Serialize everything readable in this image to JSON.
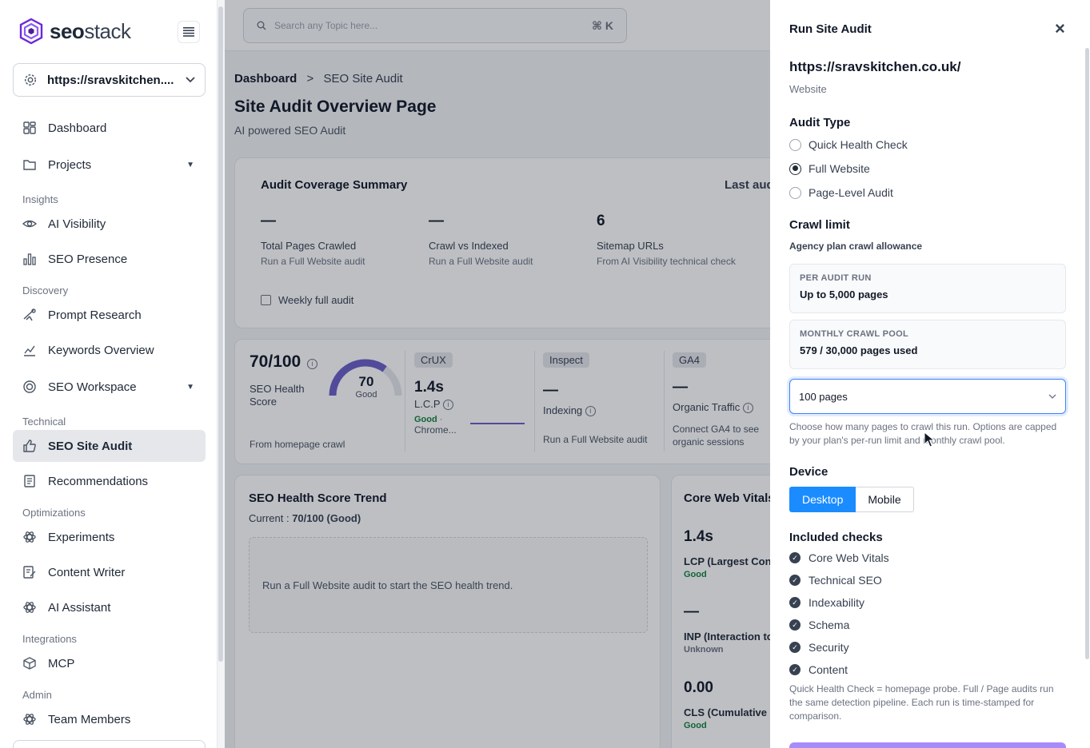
{
  "brand": {
    "name_bold": "seo",
    "name_light": "stack"
  },
  "site_select": {
    "value": "https://sravskitchen...."
  },
  "sidebar": {
    "dashboard": "Dashboard",
    "projects": "Projects",
    "sections": {
      "insights": "Insights",
      "discovery": "Discovery",
      "technical": "Technical",
      "optimizations": "Optimizations",
      "integrations": "Integrations",
      "admin": "Admin"
    },
    "ai_visibility": "AI Visibility",
    "seo_presence": "SEO Presence",
    "prompt_research": "Prompt Research",
    "keywords_overview": "Keywords Overview",
    "seo_workspace": "SEO Workspace",
    "seo_site_audit": "SEO Site Audit",
    "recommendations": "Recommendations",
    "experiments": "Experiments",
    "content_writer": "Content Writer",
    "ai_assistant": "AI Assistant",
    "mcp": "MCP",
    "team_members": "Team Members"
  },
  "search": {
    "placeholder": "Search any Topic here...",
    "shortcut": "⌘ K"
  },
  "breadcrumb": {
    "root": "Dashboard",
    "sep": ">",
    "current": "SEO Site Audit"
  },
  "page": {
    "title": "Site Audit Overview Page",
    "subtitle": "AI powered SEO Audit"
  },
  "coverage": {
    "title": "Audit Coverage Summary",
    "last_audit": "Last aud",
    "stats": [
      {
        "value": "—",
        "label": "Total Pages Crawled",
        "sub": "Run a Full Website audit"
      },
      {
        "value": "—",
        "label": "Crawl vs Indexed",
        "sub": "Run a Full Website audit"
      },
      {
        "value": "6",
        "label": "Sitemap URLs",
        "sub": "From AI Visibility technical check"
      }
    ],
    "weekly": "Weekly full audit"
  },
  "health": {
    "score": "70/100",
    "label": "SEO Health Score",
    "gauge_value": "70",
    "gauge_fraction": 0.7,
    "gauge_label": "Good",
    "source": "From homepage crawl"
  },
  "crux": {
    "badge": "CrUX",
    "value": "1.4s",
    "metric": "L.C.P",
    "status": "Good",
    "sep": " ·",
    "source": "Chrome..."
  },
  "inspect": {
    "badge": "Inspect",
    "value": "—",
    "metric": "Indexing",
    "sub": "Run a Full Website audit"
  },
  "ga4": {
    "badge": "GA4",
    "value": "—",
    "metric": "Organic Traffic",
    "sub": "Connect GA4 to see organic sessions"
  },
  "trend": {
    "title": "SEO Health Score Trend",
    "current_label": "Current : ",
    "current_value": "70/100 (Good)",
    "empty": "Run a Full Website audit to start the SEO health trend."
  },
  "cwv": {
    "title": "Core Web Vitals",
    "items": [
      {
        "value": "1.4s",
        "label": "LCP (Largest Con",
        "status": "Good"
      },
      {
        "value": "—",
        "label": "INP (Interaction to",
        "status": "Unknown"
      },
      {
        "value": "0.00",
        "label": "CLS (Cumulative",
        "status": "Good"
      }
    ]
  },
  "drawer": {
    "title": "Run Site Audit",
    "close": "×",
    "url": "https://sravskitchen.co.uk/",
    "url_type": "Website",
    "audit_type_heading": "Audit Type",
    "audit_types": [
      "Quick Health Check",
      "Full Website",
      "Page-Level Audit"
    ],
    "audit_selected": "Full Website",
    "crawl_heading": "Crawl limit",
    "crawl_note": "Agency plan crawl allowance",
    "per_run_label": "PER AUDIT RUN",
    "per_run_value": "Up to 5,000 pages",
    "pool_label": "MONTHLY CRAWL POOL",
    "pool_value": "579 / 30,000 pages used",
    "crawl_select": "100 pages",
    "crawl_help": "Choose how many pages to crawl this run. Options are capped by your plan's per-run limit and monthly crawl pool.",
    "device_heading": "Device",
    "device_options": [
      "Desktop",
      "Mobile"
    ],
    "device_selected": "Desktop",
    "checks_heading": "Included checks",
    "checks": [
      "Core Web Vitals",
      "Technical SEO",
      "Indexability",
      "Schema",
      "Security",
      "Content"
    ],
    "footnote": "Quick Health Check = homepage probe. Full / Page audits run the same detection pipeline. Each run is time-stamped for comparison."
  },
  "colors": {
    "accent": "#1a8cff",
    "gauge": "#6b5fc7",
    "run_button": "#a78bfa"
  }
}
